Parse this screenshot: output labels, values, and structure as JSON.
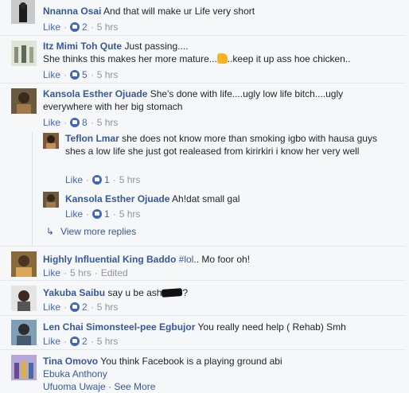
{
  "comments": [
    {
      "name": "Nnanna Osai",
      "text": "And that will make ur Life very short",
      "like": "Like",
      "count": "2",
      "time": "5 hrs"
    },
    {
      "name": "Itz Mimi Toh Qute",
      "text1": "Just passing....",
      "text2a": "She thinks this makes her more mature...",
      "text2b": "..keep it up ass hoe chicken..",
      "like": "Like",
      "count": "5",
      "time": "5 hrs"
    },
    {
      "name": "Kansola Esther Ojuade",
      "text": "She's done with life....ugly low life bitch....ugly everywhere with her big stomach",
      "like": "Like",
      "count": "8",
      "time": "5 hrs"
    },
    {
      "name": "Teflon Lmar",
      "text": "she does not know more than smoking igbo with hausa guys shes a low life she just got realeased from kirirkiri i know her very well",
      "like": "Like",
      "count": "1",
      "time": "5 hrs"
    },
    {
      "name": "Kansola Esther Ojuade",
      "text": "Ah!dat small gal",
      "like": "Like",
      "count": "1",
      "time": "5 hrs"
    },
    {
      "name": "Highly Influential King Baddo",
      "tag": "#lol",
      "text": ".. Mo foor oh!",
      "like": "Like",
      "time": "5 hrs",
      "edited": "Edited"
    },
    {
      "name": "Yakuba Saibu",
      "text_a": "say u be ash",
      "text_b": "?",
      "like": "Like",
      "count": "2",
      "time": "5 hrs"
    },
    {
      "name": "Len Chai Simonsteel-pee Egbujor",
      "text": "You really need help ( Rehab) Smh",
      "like": "Like",
      "count": "2",
      "time": "5 hrs"
    },
    {
      "name": "Tina Omovo",
      "text": "You think Facebook is a playing ground abi",
      "mention": "Ebuka Anthony",
      "cut": "Ufuoma Uwaje · See More"
    }
  ],
  "view_more": "View more replies",
  "colors": {
    "link": "#365899",
    "like": "#4267b2",
    "meta": "#90949c",
    "bg": "#f6f7f9"
  }
}
